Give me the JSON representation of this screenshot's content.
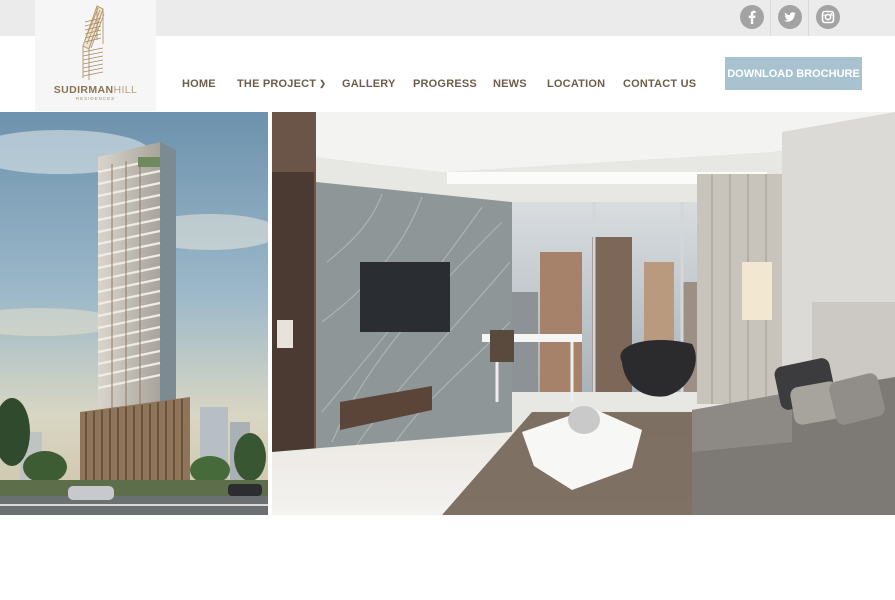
{
  "brand": {
    "name_bold": "SUDIRMAN",
    "name_light": "HILL",
    "subtitle": "RESIDENCES"
  },
  "social": [
    {
      "icon": "facebook-icon",
      "glyph": "f"
    },
    {
      "icon": "twitter-icon",
      "glyph": "t"
    },
    {
      "icon": "instagram-icon",
      "glyph": "ig"
    }
  ],
  "nav": {
    "home": "HOME",
    "project": "THE PROJECT",
    "gallery": "GALLERY",
    "progress": "PROGRESS",
    "news": "NEWS",
    "location": "LOCATION",
    "contact": "CONTACT US"
  },
  "cta": {
    "brochure": "DOWNLOAD BROCHURE"
  },
  "colors": {
    "topbar": "#ebebeb",
    "nav_text": "#6e5d4a",
    "brand": "#8a7350",
    "button": "#a8c3cf"
  }
}
